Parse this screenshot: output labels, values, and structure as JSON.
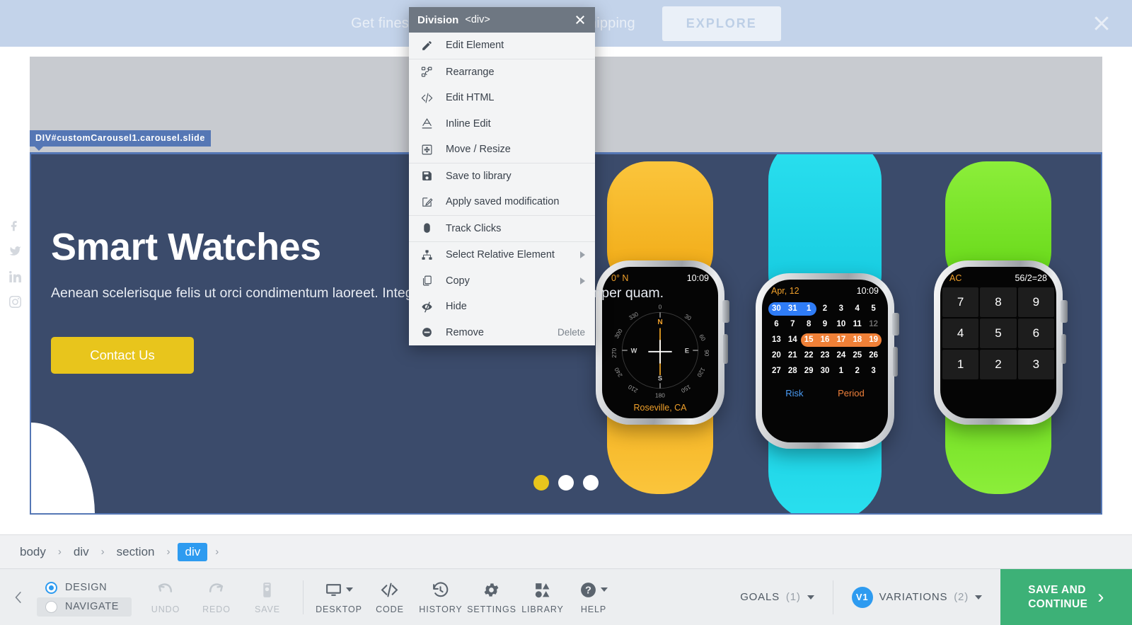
{
  "preview": {
    "promo": {
      "text": "Get finest quality products with free shipping",
      "button": "EXPLORE",
      "close_icon": "close-icon"
    },
    "selection_label": "DIV#customCarousel1.carousel.slide",
    "hero": {
      "title": "Smart Watches",
      "subtitle": "Aenean scelerisque felis ut orci condimentum laoreet. Integer augue sit amet, lobortis semper quam.",
      "cta": "Contact Us",
      "bg_color": "#3b4b6b",
      "cta_color": "#e8c51c"
    },
    "carousel_dots": [
      {
        "active": true
      },
      {
        "active": false
      },
      {
        "active": false
      }
    ],
    "social": [
      {
        "name": "facebook-icon"
      },
      {
        "name": "twitter-icon"
      },
      {
        "name": "linkedin-icon"
      },
      {
        "name": "instagram-icon"
      }
    ],
    "watches": [
      {
        "id": "compass-watch",
        "band_color": "#f5b524",
        "status_left": "0° N",
        "status_right": "10:09",
        "city": "Roseville, CA",
        "bearings": [
          "0",
          "30",
          "60",
          "90",
          "120",
          "150",
          "180",
          "210",
          "240",
          "270",
          "300",
          "330"
        ],
        "cardinals": [
          "N",
          "E",
          "S",
          "W"
        ]
      },
      {
        "id": "calendar-watch",
        "band_color": "#22d3e8",
        "status_left": "Apr, 12",
        "status_right": "10:09",
        "weeks": [
          [
            "30",
            "31",
            "1",
            "2",
            "3",
            "4",
            "5"
          ],
          [
            "6",
            "7",
            "8",
            "9",
            "10",
            "11",
            "12"
          ],
          [
            "13",
            "14",
            "15",
            "16",
            "17",
            "18",
            "19"
          ],
          [
            "20",
            "21",
            "22",
            "23",
            "24",
            "25",
            "26"
          ],
          [
            "27",
            "28",
            "29",
            "30",
            "1",
            "2",
            "3"
          ]
        ],
        "dim_cells": [
          "1:6"
        ],
        "footer": [
          "Risk",
          "Period"
        ]
      },
      {
        "id": "calculator-watch",
        "band_color": "#6fdd1e",
        "status_left": "AC",
        "status_right": "56/2=28",
        "keys": [
          "7",
          "8",
          "9",
          "4",
          "5",
          "6",
          "1",
          "2",
          "3"
        ]
      }
    ]
  },
  "context_menu": {
    "title": "Division",
    "tag": "<div>",
    "close_icon": "close-icon",
    "groups": [
      {
        "items": [
          {
            "label": "Edit Element",
            "icon": "pencil-icon",
            "shortcut": "",
            "submenu": false
          }
        ]
      },
      {
        "items": [
          {
            "label": "Rearrange",
            "icon": "rearrange-icon",
            "shortcut": "",
            "submenu": false
          },
          {
            "label": "Edit HTML",
            "icon": "code-icon",
            "shortcut": "",
            "submenu": false
          },
          {
            "label": "Inline Edit",
            "icon": "text-a-icon",
            "shortcut": "",
            "submenu": false
          },
          {
            "label": "Move / Resize",
            "icon": "move-resize-icon",
            "shortcut": "",
            "submenu": false
          }
        ]
      },
      {
        "items": [
          {
            "label": "Save to library",
            "icon": "floppy-disk-icon",
            "shortcut": "",
            "submenu": false
          },
          {
            "label": "Apply saved modification",
            "icon": "apply-modification-icon",
            "shortcut": "",
            "submenu": false
          }
        ]
      },
      {
        "items": [
          {
            "label": "Track Clicks",
            "icon": "mouse-icon",
            "shortcut": "",
            "submenu": false
          }
        ]
      },
      {
        "items": [
          {
            "label": "Select Relative Element",
            "icon": "sitemap-icon",
            "shortcut": "",
            "submenu": true
          },
          {
            "label": "Copy",
            "icon": "copy-icon",
            "shortcut": "",
            "submenu": true
          },
          {
            "label": "Hide",
            "icon": "eye-slash-icon",
            "shortcut": "",
            "submenu": false
          },
          {
            "label": "Remove",
            "icon": "minus-circle-icon",
            "shortcut": "Delete",
            "submenu": false
          }
        ]
      }
    ]
  },
  "breadcrumb": {
    "items": [
      {
        "label": "body",
        "active": false
      },
      {
        "label": "div",
        "active": false
      },
      {
        "label": "section",
        "active": false
      },
      {
        "label": "div",
        "active": true
      }
    ],
    "separator": "›"
  },
  "toolbar": {
    "collapse_icon": "chevron-left-icon",
    "modes": [
      {
        "label": "DESIGN",
        "selected": true
      },
      {
        "label": "NAVIGATE",
        "selected": false
      }
    ],
    "actions": [
      {
        "label": "UNDO",
        "icon": "undo-arrow-icon",
        "disabled": true,
        "caret": false
      },
      {
        "label": "REDO",
        "icon": "redo-arrow-icon",
        "disabled": true,
        "caret": false
      },
      {
        "label": "SAVE",
        "icon": "save-device-icon",
        "disabled": true,
        "caret": false
      }
    ],
    "tools": [
      {
        "label": "DESKTOP",
        "icon": "monitor-icon",
        "disabled": false,
        "caret": true
      },
      {
        "label": "CODE",
        "icon": "code-icon",
        "disabled": false,
        "caret": false
      },
      {
        "label": "HISTORY",
        "icon": "history-clock-icon",
        "disabled": false,
        "caret": false
      },
      {
        "label": "SETTINGS",
        "icon": "gear-icon",
        "disabled": false,
        "caret": false
      },
      {
        "label": "LIBRARY",
        "icon": "library-shapes-icon",
        "disabled": false,
        "caret": false
      },
      {
        "label": "HELP",
        "icon": "question-circle-icon",
        "disabled": false,
        "caret": true
      }
    ],
    "goals": {
      "label": "GOALS",
      "count": "(1)"
    },
    "variations": {
      "badge": "V1",
      "label": "VARIATIONS",
      "count": "(2)"
    },
    "save_continue": {
      "line1": "SAVE AND",
      "line2": "CONTINUE",
      "chevron": "›",
      "color": "#3db177"
    }
  }
}
